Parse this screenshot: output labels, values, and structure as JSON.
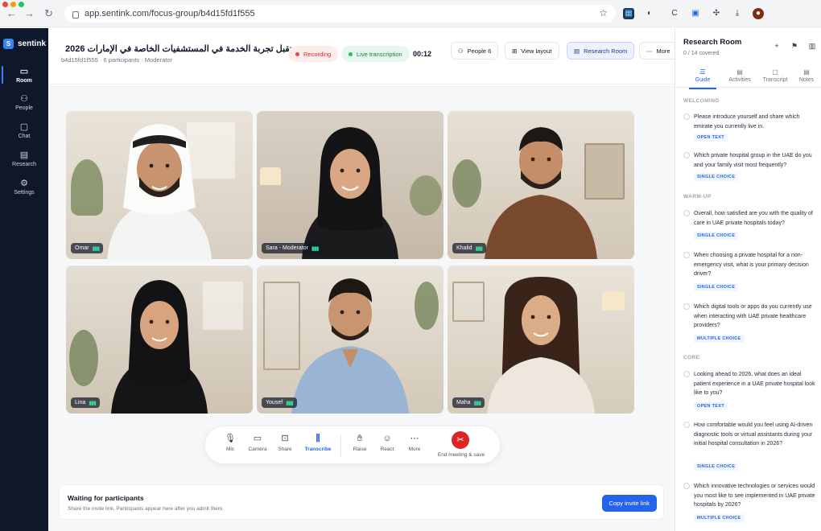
{
  "browser": {
    "url": "app.sentink.com/focus-group/b4d15fd1f555",
    "dot_colors": [
      "#ef4444",
      "#f59e0b",
      "#22c55e"
    ]
  },
  "brand": {
    "name": "sentink",
    "logo_letter": "S",
    "accent": "#3b82f6"
  },
  "nav": {
    "items": [
      {
        "label": "Room",
        "icon": "camera-icon"
      },
      {
        "label": "People",
        "icon": "people-icon"
      },
      {
        "label": "Chat",
        "icon": "chat-icon"
      },
      {
        "label": "Research",
        "icon": "research-icon"
      },
      {
        "label": "Settings",
        "icon": "settings-icon"
      }
    ],
    "active": "Room"
  },
  "header": {
    "title": "مستقبل تجربة الخدمة في المستشفيات الخاصة في الإمارات 2026",
    "subtitle": "b4d15fd1f555 · 6 participants · Moderator",
    "recording": "Recording",
    "live_transcription": "Live transcription",
    "timer": "00:12",
    "people_button": "People 6",
    "view_layout_button": "View layout",
    "research_room_button": "Research Room",
    "more_button": "More"
  },
  "participants": [
    {
      "name": "Omar"
    },
    {
      "name": "Sara - Moderator"
    },
    {
      "name": "Khalid"
    },
    {
      "name": "Lina"
    },
    {
      "name": "Yousef"
    },
    {
      "name": "Maha"
    }
  ],
  "controls": {
    "mic": "Mic",
    "camera": "Camera",
    "share": "Share",
    "transcribe": "Transcribe",
    "raise": "Raise",
    "react": "React",
    "more": "More",
    "end": "End meeting & save"
  },
  "waiting": {
    "title": "Waiting for participants",
    "hint": "Share the invite link. Participants appear here after you admit them.",
    "invite_button": "Copy invite link"
  },
  "research_panel": {
    "title": "Research Room",
    "covered": "0 / 14 covered",
    "tabs": [
      "Guide",
      "Activities",
      "Transcript",
      "Notes"
    ],
    "active_tab": "Guide",
    "sections": [
      {
        "name": "WELCOMING"
      },
      {
        "name": "WARM-UP"
      },
      {
        "name": "CORE"
      }
    ],
    "questions": [
      {
        "text": "Please introduce yourself and share which emirate you currently live in.",
        "type": "OPEN TEXT"
      },
      {
        "text": "Which private hospital group in the UAE do you and your family visit most frequently?",
        "type": "SINGLE CHOICE"
      },
      {
        "text": "Overall, how satisfied are you with the quality of care in UAE private hospitals today?",
        "type": "SINGLE CHOICE"
      },
      {
        "text": "When choosing a private hospital for a non-emergency visit, what is your primary decision driver?",
        "type": "SINGLE CHOICE"
      },
      {
        "text": "Which digital tools or apps do you currently use when interacting with UAE private healthcare providers?",
        "type": "MULTIPLE CHOICE"
      },
      {
        "text": "Looking ahead to 2026, what does an ideal patient experience in a UAE private hospital look like to you?",
        "type": "OPEN TEXT"
      },
      {
        "text": "How comfortable would you feel using AI-driven diagnostic tools or virtual assistants during your initial hospital consultation in 2026?",
        "type": "SINGLE CHOICE"
      },
      {
        "text": "Which innovative technologies or services would you most like to see implemented in UAE private hospitals by 2026?",
        "type": "MULTIPLE CHOICE"
      }
    ]
  }
}
